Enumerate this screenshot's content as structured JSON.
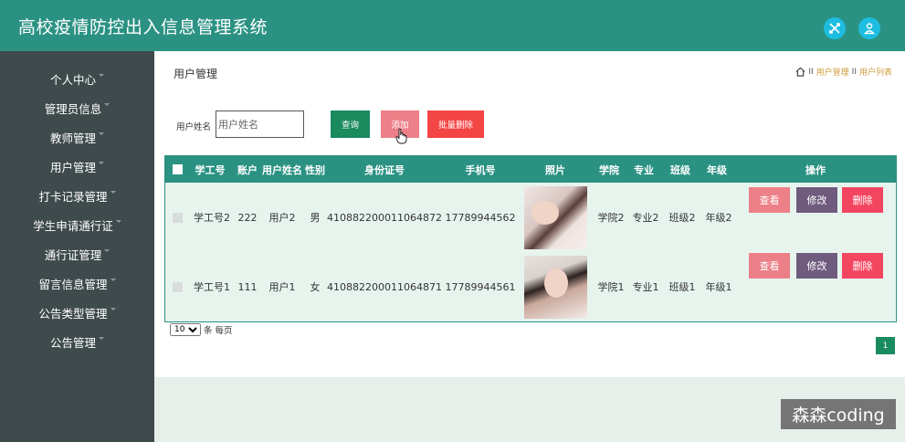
{
  "header": {
    "title": "高校疫情防控出入信息管理系统",
    "color": "#2b9283"
  },
  "sidebar": {
    "items": [
      {
        "label": "个人中心"
      },
      {
        "label": "管理员信息"
      },
      {
        "label": "教师管理"
      },
      {
        "label": "用户管理"
      },
      {
        "label": "打卡记录管理"
      },
      {
        "label": "学生申请通行证"
      },
      {
        "label": "通行证管理"
      },
      {
        "label": "留言信息管理"
      },
      {
        "label": "公告类型管理"
      },
      {
        "label": "公告管理"
      }
    ]
  },
  "main": {
    "page_title": "用户管理",
    "breadcrumb": [
      "用户管理",
      "用户列表"
    ],
    "breadcrumb_sep": "II",
    "search": {
      "label": "用户姓名",
      "placeholder": "用户姓名"
    },
    "buttons": {
      "query": "查询",
      "add": "添加",
      "batch_delete": "批量删除"
    },
    "table": {
      "columns": [
        "学工号",
        "账户",
        "用户姓名",
        "性别",
        "身份证号",
        "手机号",
        "照片",
        "学院",
        "专业",
        "班级",
        "年级",
        "操作"
      ],
      "rows": [
        {
          "id": "学工号2",
          "account": "222",
          "name": "用户2",
          "gender": "男",
          "id_card": "410882200011064872",
          "phone": "17789944562",
          "college": "学院2",
          "major": "专业2",
          "class": "班级2",
          "grade": "年级2"
        },
        {
          "id": "学工号1",
          "account": "111",
          "name": "用户1",
          "gender": "女",
          "id_card": "410882200011064871",
          "phone": "17789944561",
          "college": "学院1",
          "major": "专业1",
          "class": "班级1",
          "grade": "年级1"
        }
      ],
      "actions": {
        "view": "查看",
        "edit": "修改",
        "delete": "删除"
      }
    },
    "pagination": {
      "page_size": "10",
      "page_size_suffix": "条 每页",
      "current_page": "1"
    }
  },
  "watermark": "森森coding",
  "colors": {
    "accent": "#2b9283",
    "query": "#1a8b5f",
    "add": "#ec7f87",
    "danger": "#f44545",
    "edit": "#6f5b7e"
  }
}
